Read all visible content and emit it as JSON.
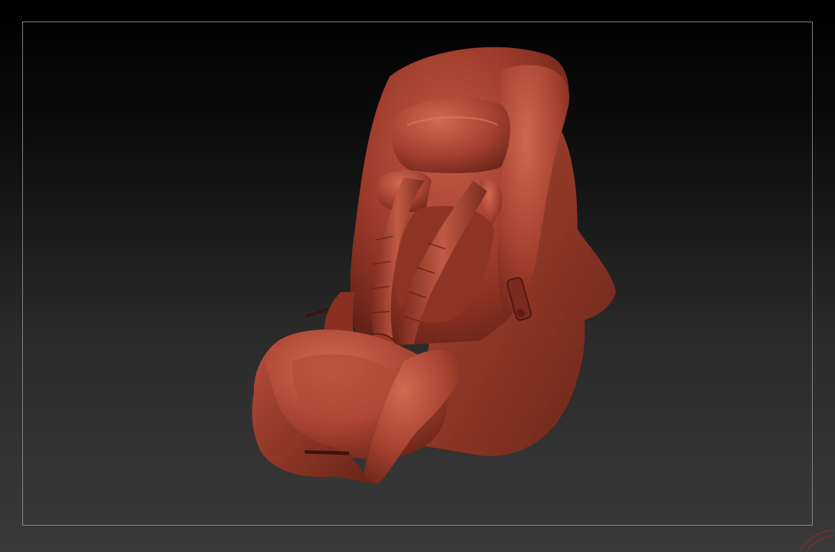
{
  "viewport": {
    "model": {
      "name": "car-seat-sculpt",
      "material_color": "#a8402e",
      "highlight_color": "#d9705a",
      "shadow_color": "#5a1c14"
    }
  }
}
